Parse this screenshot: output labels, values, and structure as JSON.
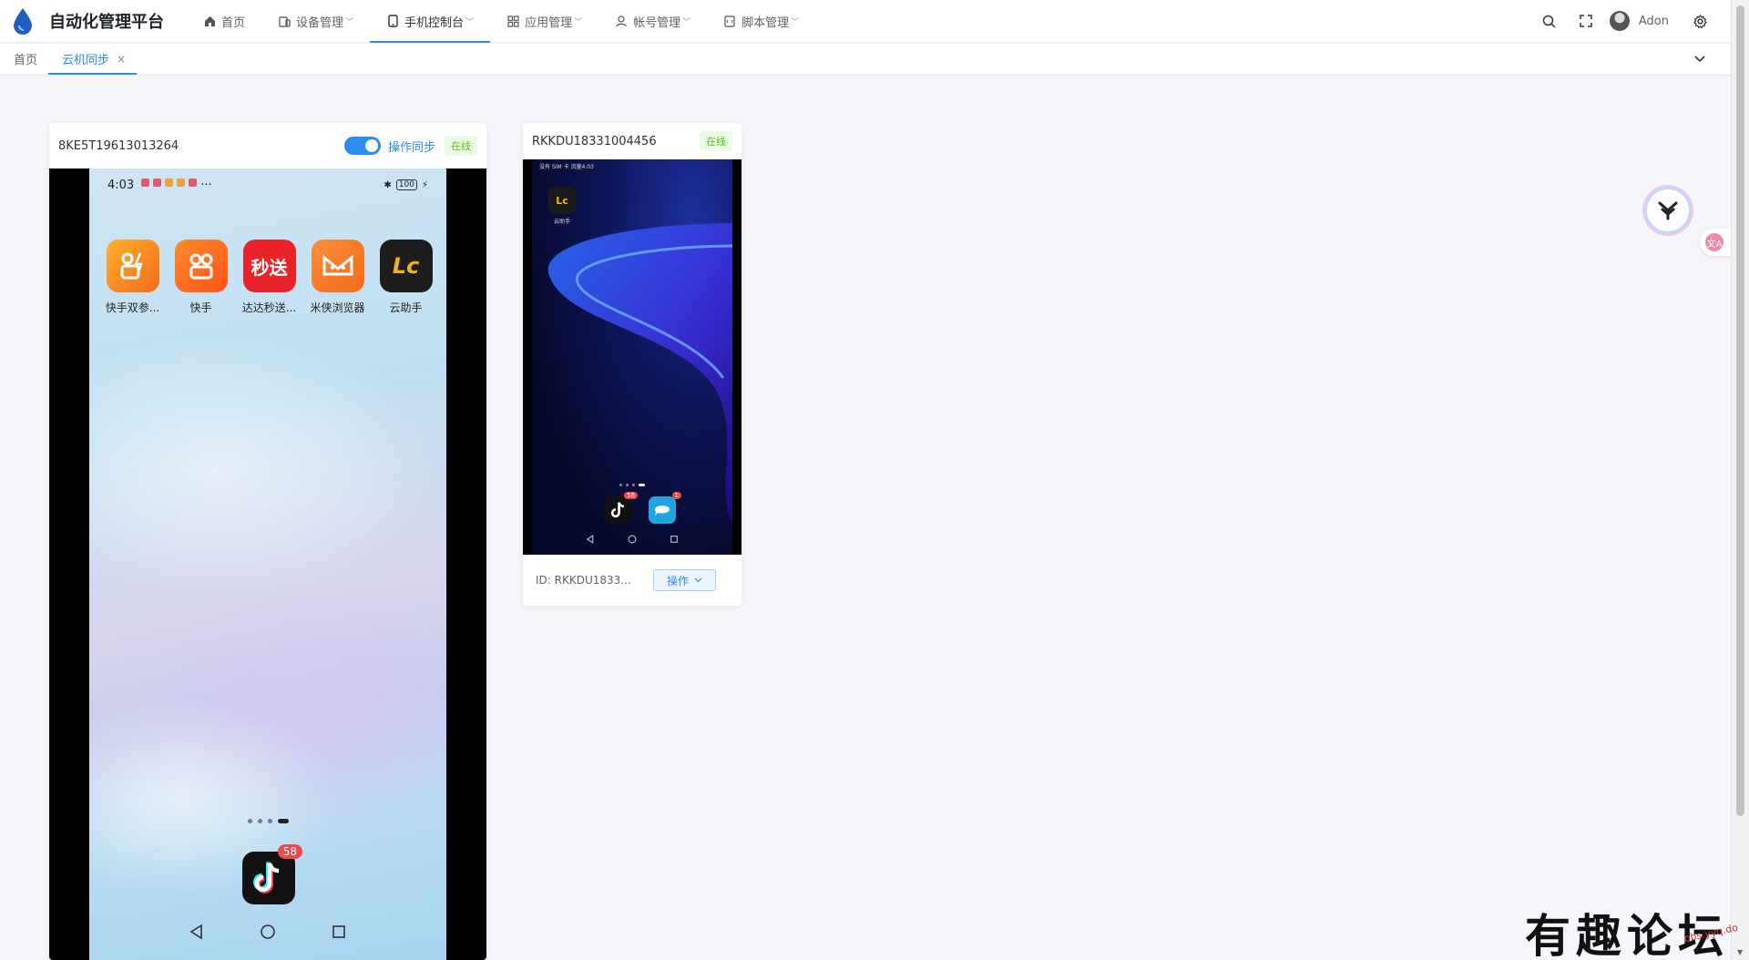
{
  "brand": {
    "title": "自动化管理平台"
  },
  "nav": [
    {
      "label": "首页",
      "icon": "home-icon",
      "dropdown": false
    },
    {
      "label": "设备管理",
      "icon": "device-icon",
      "dropdown": true
    },
    {
      "label": "手机控制台",
      "icon": "phone-icon",
      "dropdown": true,
      "active": true
    },
    {
      "label": "应用管理",
      "icon": "grid-icon",
      "dropdown": true
    },
    {
      "label": "帐号管理",
      "icon": "user-icon",
      "dropdown": true
    },
    {
      "label": "脚本管理",
      "icon": "script-icon",
      "dropdown": true
    }
  ],
  "header_right": {
    "user_name": "Adon"
  },
  "tags": [
    {
      "label": "首页"
    },
    {
      "label": "云机同步",
      "active": true,
      "close": "×"
    }
  ],
  "card1": {
    "device_id": "8KE5T19613013264",
    "sync_label": "操作同步",
    "sync_on": true,
    "status": "在线",
    "screen": {
      "time": "4:03",
      "battery": "100",
      "more": "···",
      "apps": [
        {
          "label": "快手双参...",
          "glyph": "快",
          "color": "#f7941d"
        },
        {
          "label": "快手",
          "glyph": "快",
          "color": "#ff6a1c"
        },
        {
          "label": "达达秒送...",
          "glyph": "秒送",
          "color": "#e8232a"
        },
        {
          "label": "米侠浏览器",
          "glyph": "米",
          "color": "#f57a24"
        },
        {
          "label": "云助手",
          "glyph": "Lc",
          "color": "#222222"
        }
      ],
      "dock_badge": "58"
    }
  },
  "card2": {
    "device_id": "RKKDU18331004456",
    "status": "在线",
    "screen": {
      "status_text": "没有 SIM 卡 流量4:03",
      "app_label": "云助手",
      "tiktok_badge": "58",
      "msg_badge": "1"
    },
    "footer_id": "ID: RKKDU1833...",
    "op_label": "操作"
  },
  "float": {
    "translate_glyph": "文A"
  },
  "watermark": {
    "text": "有趣论坛",
    "sub": "bbs.yyq.do"
  },
  "colors": {
    "accent": "#2d8cf0",
    "online": "#52c41a"
  }
}
